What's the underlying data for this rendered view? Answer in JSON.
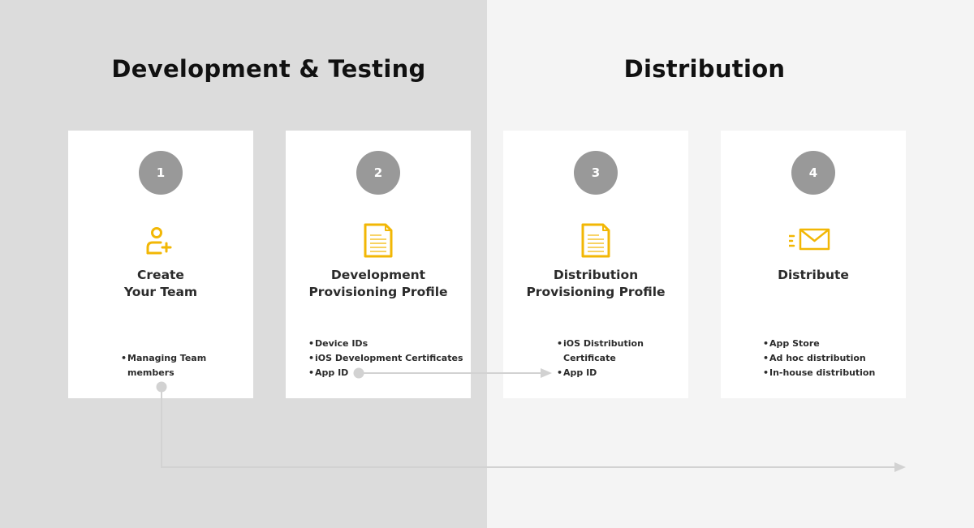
{
  "sections": {
    "left_title": "Development & Testing",
    "right_title": "Distribution"
  },
  "colors": {
    "left_background": "#dcdcdc",
    "right_background": "#f4f4f4",
    "card_background": "#ffffff",
    "step_circle": "#999999",
    "icon_accent": "#f2b705",
    "connector": "#d2d2d2"
  },
  "cards": [
    {
      "step": "1",
      "icon": "add-user-icon",
      "title_lines": [
        "Create",
        "Your Team"
      ],
      "bullets": [
        [
          "Managing Team",
          "members"
        ]
      ]
    },
    {
      "step": "2",
      "icon": "document-icon",
      "title_lines": [
        "Development",
        "Provisioning Profile"
      ],
      "bullets": [
        [
          "Device IDs"
        ],
        [
          "iOS Development Certificates"
        ],
        [
          "App ID"
        ]
      ]
    },
    {
      "step": "3",
      "icon": "document-icon",
      "title_lines": [
        "Distribution",
        "Provisioning Profile"
      ],
      "bullets": [
        [
          "iOS Distribution",
          "Certificate"
        ],
        [
          "App ID"
        ]
      ]
    },
    {
      "step": "4",
      "icon": "mail-send-icon",
      "title_lines": [
        "Distribute"
      ],
      "bullets": [
        [
          "App Store"
        ],
        [
          "Ad hoc distribution"
        ],
        [
          "In-house distribution"
        ]
      ]
    }
  ]
}
